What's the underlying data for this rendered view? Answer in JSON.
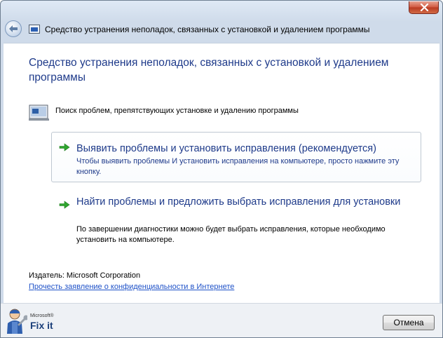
{
  "window": {
    "title": "Средство устранения неполадок, связанных с установкой и удалением программы"
  },
  "main": {
    "heading": "Средство устранения неполадок, связанных с установкой и удалением программы",
    "status_text": "Поиск проблем, препятствующих установке и удалению программы",
    "options": [
      {
        "title": "Выявить проблемы и установить исправления (рекомендуется)",
        "description": "Чтобы выявить проблемы И установить исправления на компьютере, просто нажмите эту кнопку."
      },
      {
        "title": "Найти проблемы и предложить выбрать исправления для установки",
        "description": "По завершении диагностики можно будет выбрать исправления, которые необходимо установить на компьютере."
      }
    ],
    "publisher": "Издатель: Microsoft Corporation",
    "privacy_link": "Прочесть заявление о конфиденциальности в Интернете"
  },
  "footer": {
    "brand_small": "Microsoft®",
    "brand": "Fix it",
    "cancel_label": "Отмена"
  },
  "icons": {
    "back": "back-arrow-icon",
    "close": "close-icon",
    "option_arrow": "green-arrow-icon"
  },
  "colors": {
    "heading": "#1e3a8a",
    "link": "#1f52c8",
    "arrow": "#2fa62f"
  }
}
